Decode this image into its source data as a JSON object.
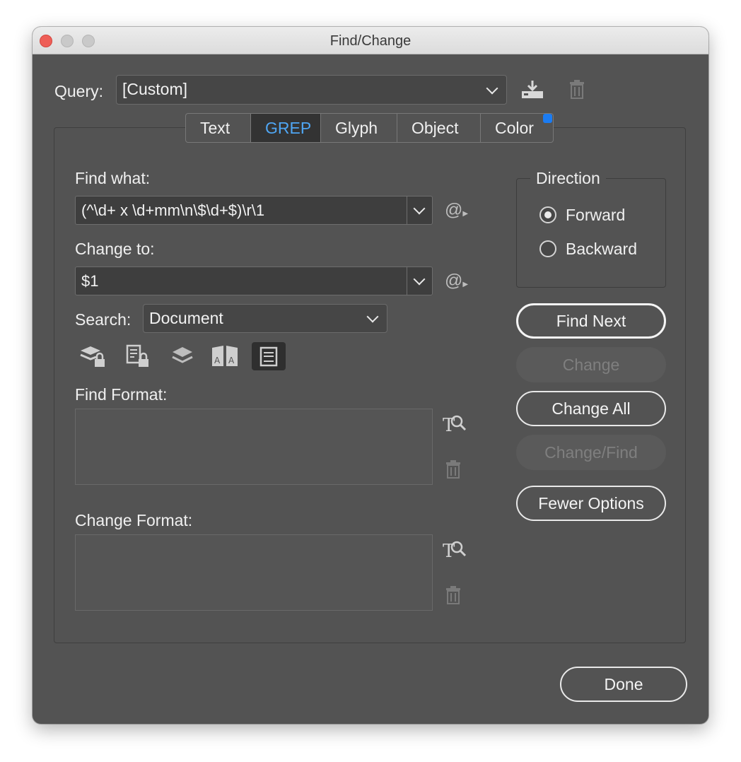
{
  "window": {
    "title": "Find/Change"
  },
  "query": {
    "label": "Query:",
    "value": "[Custom]"
  },
  "tabs": [
    {
      "label": "Text"
    },
    {
      "label": "GREP"
    },
    {
      "label": "Glyph"
    },
    {
      "label": "Object"
    },
    {
      "label": "Color"
    }
  ],
  "active_tab": "GREP",
  "find_what": {
    "label": "Find what:",
    "value": "(^\\d+ x \\d+mm\\n\\$\\d+$)\\r\\1"
  },
  "change_to": {
    "label": "Change to:",
    "value": "$1"
  },
  "search": {
    "label": "Search:",
    "value": "Document"
  },
  "find_format": {
    "label": "Find Format:"
  },
  "change_format": {
    "label": "Change Format:"
  },
  "direction": {
    "title": "Direction",
    "options": [
      {
        "label": "Forward",
        "checked": true
      },
      {
        "label": "Backward",
        "checked": false
      }
    ]
  },
  "buttons": {
    "find_next": "Find Next",
    "change": "Change",
    "change_all": "Change All",
    "change_find": "Change/Find",
    "fewer_options": "Fewer Options",
    "done": "Done"
  },
  "icons": {
    "special_char": "@",
    "format_glyph": "T"
  },
  "colors": {
    "accent": "#4fa6f3",
    "badge": "#1b7cf2",
    "dialog_bg": "#535353",
    "close": "#ee5e57"
  }
}
